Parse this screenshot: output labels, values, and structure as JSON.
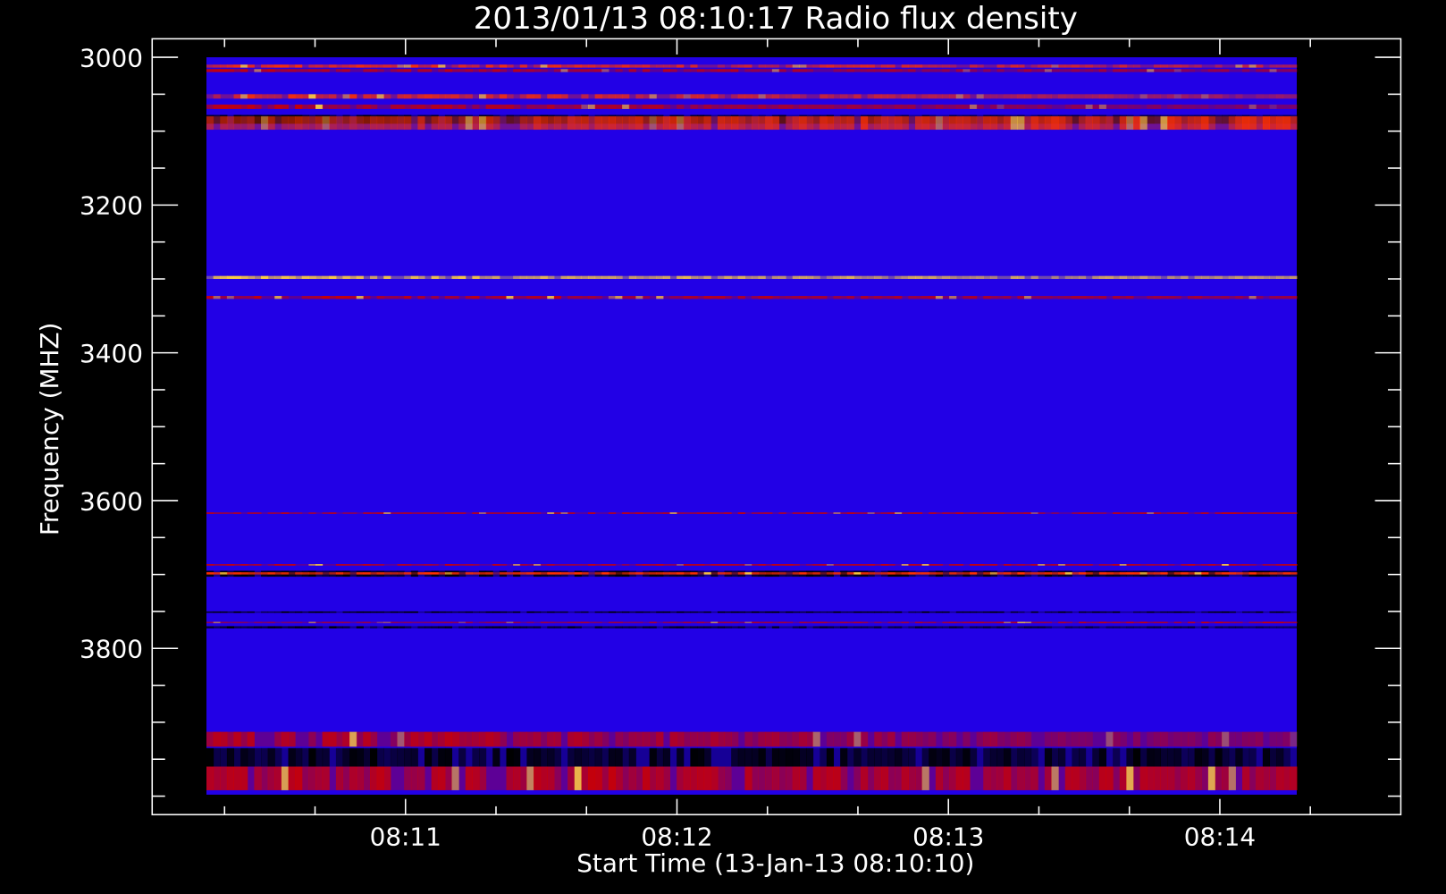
{
  "chart_data": {
    "type": "heatmap",
    "title": "2013/01/13 08:10:17 Radio flux density",
    "xlabel": "Start Time (13-Jan-13 08:10:10)",
    "ylabel": "Frequency (MHZ)",
    "x_range_seconds": [
      -6,
      270
    ],
    "x_data_range_seconds": [
      6,
      247
    ],
    "x_ticks": [
      {
        "sec": 50,
        "label": "08:11"
      },
      {
        "sec": 110,
        "label": "08:12"
      },
      {
        "sec": 170,
        "label": "08:13"
      },
      {
        "sec": 230,
        "label": "08:14"
      }
    ],
    "x_minor_step_seconds": 20,
    "y_range": [
      2975,
      4025
    ],
    "y_data_range": [
      3000,
      3998
    ],
    "y_ticks": [
      {
        "v": 3000,
        "label": "3000"
      },
      {
        "v": 3200,
        "label": "3200"
      },
      {
        "v": 3400,
        "label": "3400"
      },
      {
        "v": 3600,
        "label": "3600"
      },
      {
        "v": 3800,
        "label": "3800"
      }
    ],
    "y_minor_step": 50,
    "y_inverted": true,
    "background_color": "#2200e6",
    "colors": {
      "low": "#000000",
      "mid": "#cc0000",
      "high": "#ff3000",
      "peak": "#ffd040"
    },
    "bands": [
      {
        "f0": 3010,
        "f1": 3014,
        "level": "high",
        "fade": 0.4
      },
      {
        "f0": 3016,
        "f1": 3020,
        "level": "mid",
        "fade": 0.5
      },
      {
        "f0": 3050,
        "f1": 3056,
        "level": "high",
        "fade": 0.7
      },
      {
        "f0": 3064,
        "f1": 3070,
        "level": "mid",
        "fade": 0.7
      },
      {
        "f0": 3078,
        "f1": 3090,
        "level": "low",
        "fade": 0.5
      },
      {
        "f0": 3080,
        "f1": 3098,
        "level": "high",
        "fade": -0.5
      },
      {
        "f0": 3296,
        "f1": 3300,
        "level": "peak",
        "fade": 0.4
      },
      {
        "f0": 3323,
        "f1": 3327,
        "level": "mid",
        "fade": 0.4
      },
      {
        "f0": 3616,
        "f1": 3618,
        "level": "mid",
        "fade": 0
      },
      {
        "f0": 3686,
        "f1": 3688,
        "level": "mid",
        "fade": 0
      },
      {
        "f0": 3695,
        "f1": 3703,
        "level": "low",
        "fade": 0
      },
      {
        "f0": 3697,
        "f1": 3700,
        "level": "high",
        "fade": 0
      },
      {
        "f0": 3750,
        "f1": 3752,
        "level": "low",
        "fade": 0
      },
      {
        "f0": 3764,
        "f1": 3766,
        "level": "mid",
        "fade": -0.5
      },
      {
        "f0": 3770,
        "f1": 3773,
        "level": "low",
        "fade": 0.5
      },
      {
        "f0": 3913,
        "f1": 3933,
        "level": "mid",
        "fade": 0.6
      },
      {
        "f0": 3935,
        "f1": 3960,
        "level": "low",
        "fade": 0
      },
      {
        "f0": 3960,
        "f1": 3992,
        "level": "mid",
        "fade": 0.2
      }
    ]
  }
}
